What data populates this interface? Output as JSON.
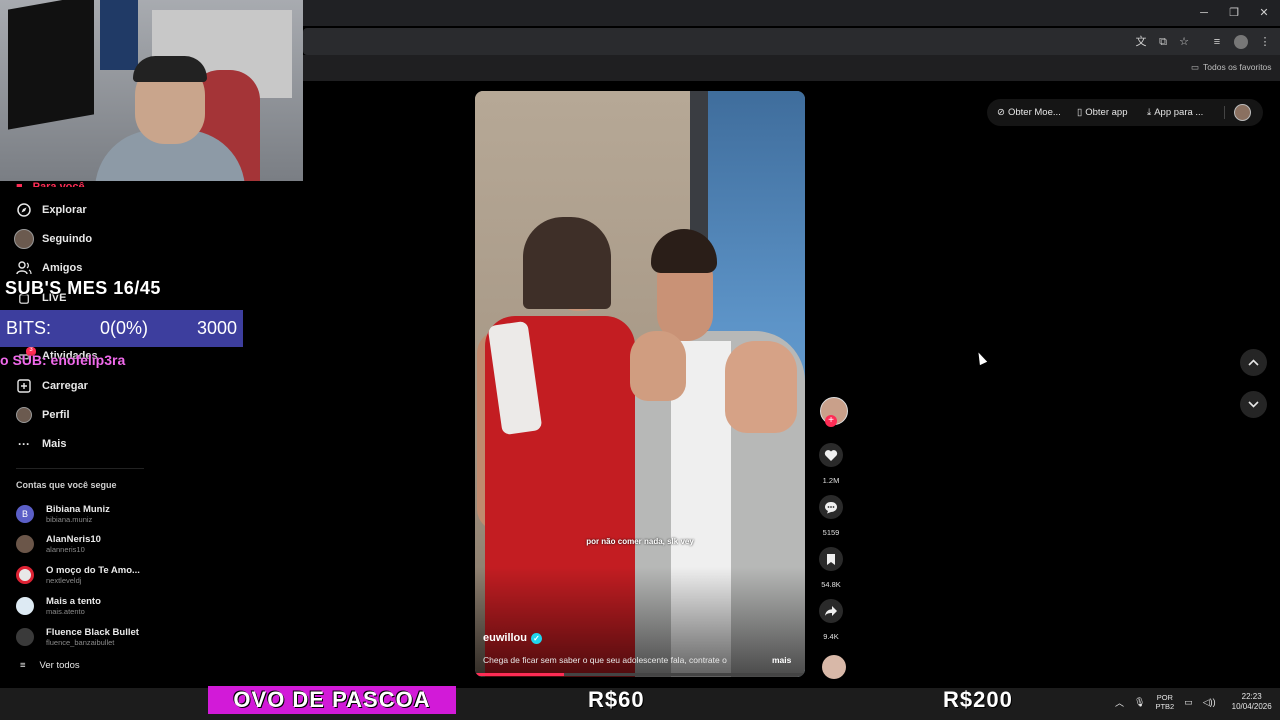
{
  "browser": {
    "bookmarks_folder": "Todos os favoritos"
  },
  "header": {
    "get_coins": "Obter Moe...",
    "get_app": "Obter app",
    "app_for": "App para ..."
  },
  "sidebar": {
    "for_you": "Para você",
    "items": [
      {
        "label": "Explorar",
        "icon": "compass-icon"
      },
      {
        "label": "Seguindo",
        "icon": "avatar"
      },
      {
        "label": "Amigos",
        "icon": "friends-icon"
      },
      {
        "label": "LIVE",
        "icon": "live-icon"
      },
      {
        "label": "Atividades",
        "icon": "inbox-icon"
      },
      {
        "label": "Carregar",
        "icon": "upload-icon"
      },
      {
        "label": "Perfil",
        "icon": "avatar"
      },
      {
        "label": "Mais",
        "icon": "more-icon"
      }
    ],
    "activity_badge": "3",
    "following_title": "Contas que você segue",
    "accounts": [
      {
        "name": "Bibiana Muniz",
        "handle": "bibiana.muniz",
        "initial": "B"
      },
      {
        "name": "AlanNeris10",
        "handle": "alanneris10",
        "initial": ""
      },
      {
        "name": "O moço do Te Amo...",
        "handle": "nextleveldj",
        "initial": ""
      },
      {
        "name": "Mais a tento",
        "handle": "mais.atento",
        "initial": ""
      },
      {
        "name": "Fluence Black Bullet",
        "handle": "fluence_banzaibullet",
        "initial": ""
      }
    ],
    "see_all": "Ver todos"
  },
  "overlay": {
    "subs_goal": "SUB'S MES 16/45",
    "bits_label": "BITS:",
    "bits_value": "0(0%)",
    "bits_goal": "3000",
    "last_sub": "o SUB: enofelip3ra",
    "easter": "OVO DE PASCOA",
    "price_1": "R$60",
    "price_2": "R$200"
  },
  "video": {
    "subtitle": "por não comer nada, slk vey",
    "author": "euwillou",
    "description": "Chega de ficar sem saber o que seu adolescente fala, contrate o",
    "more": "mais",
    "progress": 0.27
  },
  "actions": {
    "likes": "1.2M",
    "comments": "5159",
    "saves": "54.8K",
    "shares": "9.4K"
  },
  "taskbar": {
    "lang_1": "POR",
    "lang_2": "PTB2",
    "time": "22:23",
    "date": "10/04/2026"
  }
}
